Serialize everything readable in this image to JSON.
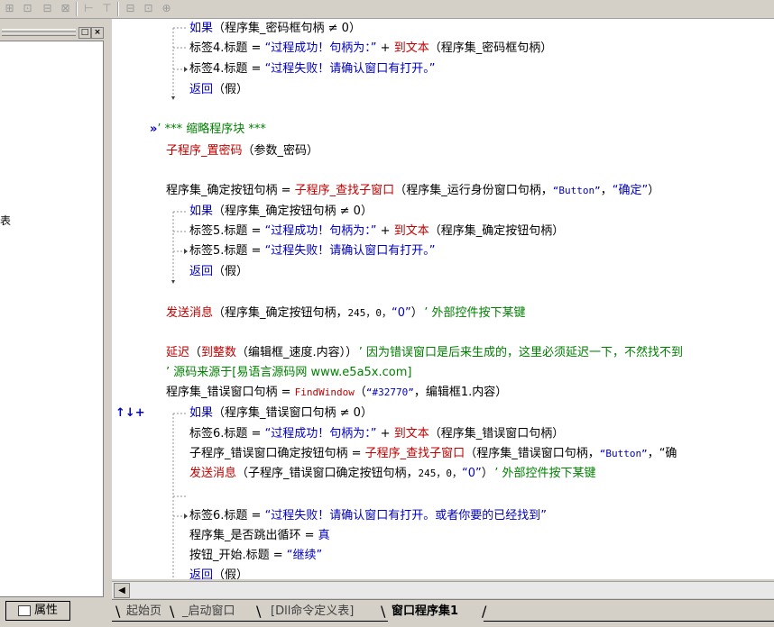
{
  "toolbar": {
    "icons": [
      "align-icon",
      "align-icon",
      "align-icon",
      "align-icon",
      "spacing-icon",
      "spacing-icon",
      "width-icon",
      "height-icon",
      "size-icon"
    ],
    "glyphs": [
      "⊞",
      "⊡",
      "⊟",
      "⊠",
      "⊢",
      "⊤",
      "⊟",
      "⊡",
      "⊕"
    ]
  },
  "left_panel": {
    "pin_btn": "□",
    "close_btn": "×",
    "partial_label": "表"
  },
  "left_tab_label": "属性",
  "code": {
    "l1_kw": "如果",
    "l1_rest": "（程序集_密码框句柄 ≠ 0）",
    "l2_a": "标签4.标题 = ",
    "l2_str": "“过程成功！句柄为：”",
    "l2_plus": " + ",
    "l2_fn": "到文本",
    "l2_rest": "（程序集_密码框句柄）",
    "l3_a": "标签4.标题 = ",
    "l3_str": "“过程失败！请确认窗口有打开。”",
    "l4_kw": "返回",
    "l4_rest": "（假）",
    "l5_mark": "»",
    "l5_text": "’ *** 缩略程序块 ***",
    "l6_fn": "子程序_置密码",
    "l6_rest": "（参数_密码）",
    "l7_a": "程序集_确定按钮句柄 = ",
    "l7_fn": "子程序_查找子窗口",
    "l7_b": "（程序集_运行身份窗口句柄，",
    "l7_s1": "“Button”",
    "l7_c": "，",
    "l7_s2": "“确定”",
    "l7_d": "）",
    "l8_kw": "如果",
    "l8_rest": "（程序集_确定按钮句柄 ≠ 0）",
    "l9_a": "标签5.标题 = ",
    "l9_str": "“过程成功！句柄为：”",
    "l9_plus": " + ",
    "l9_fn": "到文本",
    "l9_rest": "（程序集_确定按钮句柄）",
    "l10_a": "标签5.标题 = ",
    "l10_str": "“过程失败！请确认窗口有打开。”",
    "l11_kw": "返回",
    "l11_rest": "（假）",
    "l12_fn": "发送消息",
    "l12_a": "（程序集_确定按钮句柄，",
    "l12_n": "245，0，",
    "l12_s": "“0”",
    "l12_b": "）",
    "l12_c": "’ 外部控件按下某键",
    "l13_fn": "延迟",
    "l13_a": "（",
    "l13_fn2": "到整数",
    "l13_b": "（编辑框_速度.内容））",
    "l13_c": "’ 因为错误窗口是后来生成的，这里必须延迟一下，不然找不到",
    "l14_c": "’ 源码来源于[易语言源码网 www.e5a5x.com]",
    "l15_a": "程序集_错误窗口句柄 = ",
    "l15_fn": "FindWindow",
    "l15_b": "（",
    "l15_s": "“#32770”",
    "l15_c": "，编辑框1.内容）",
    "l16_mark": "↑↓+",
    "l16_kw": "如果",
    "l16_rest": "（程序集_错误窗口句柄 ≠ 0）",
    "l17_a": "标签6.标题 = ",
    "l17_str": "“过程成功！句柄为：”",
    "l17_plus": " + ",
    "l17_fn": "到文本",
    "l17_rest": "（程序集_错误窗口句柄）",
    "l18_a": "子程序_错误窗口确定按钮句柄 = ",
    "l18_fn": "子程序_查找子窗口",
    "l18_b": "（程序集_错误窗口句柄，",
    "l18_s": "“Button”",
    "l18_c": "，“确",
    "l19_fn": "发送消息",
    "l19_a": "（子程序_错误窗口确定按钮句柄，",
    "l19_n": "245，0，",
    "l19_s": "“0”",
    "l19_b": "）",
    "l19_c": "’ 外部控件按下某键",
    "l20_a": "标签6.标题 = ",
    "l20_str": "“过程失败！请确认窗口有打开。或者你要的已经找到”",
    "l21_a": "程序集_是否跳出循环 = ",
    "l21_v": "真",
    "l22_a": "按钮_开始.标题 = ",
    "l22_str": "“继续”",
    "l23_kw": "返回",
    "l23_rest": "（假）"
  },
  "hscroll": {
    "left_arrow": "◀"
  },
  "tabs": [
    {
      "label": "起始页"
    },
    {
      "label": "_启动窗口"
    },
    {
      "label": "[Dll命令定义表]"
    },
    {
      "label": "窗口程序集1"
    }
  ],
  "colors": {
    "keyword": "#0000c0",
    "function": "#c00000",
    "comment": "#008000"
  }
}
